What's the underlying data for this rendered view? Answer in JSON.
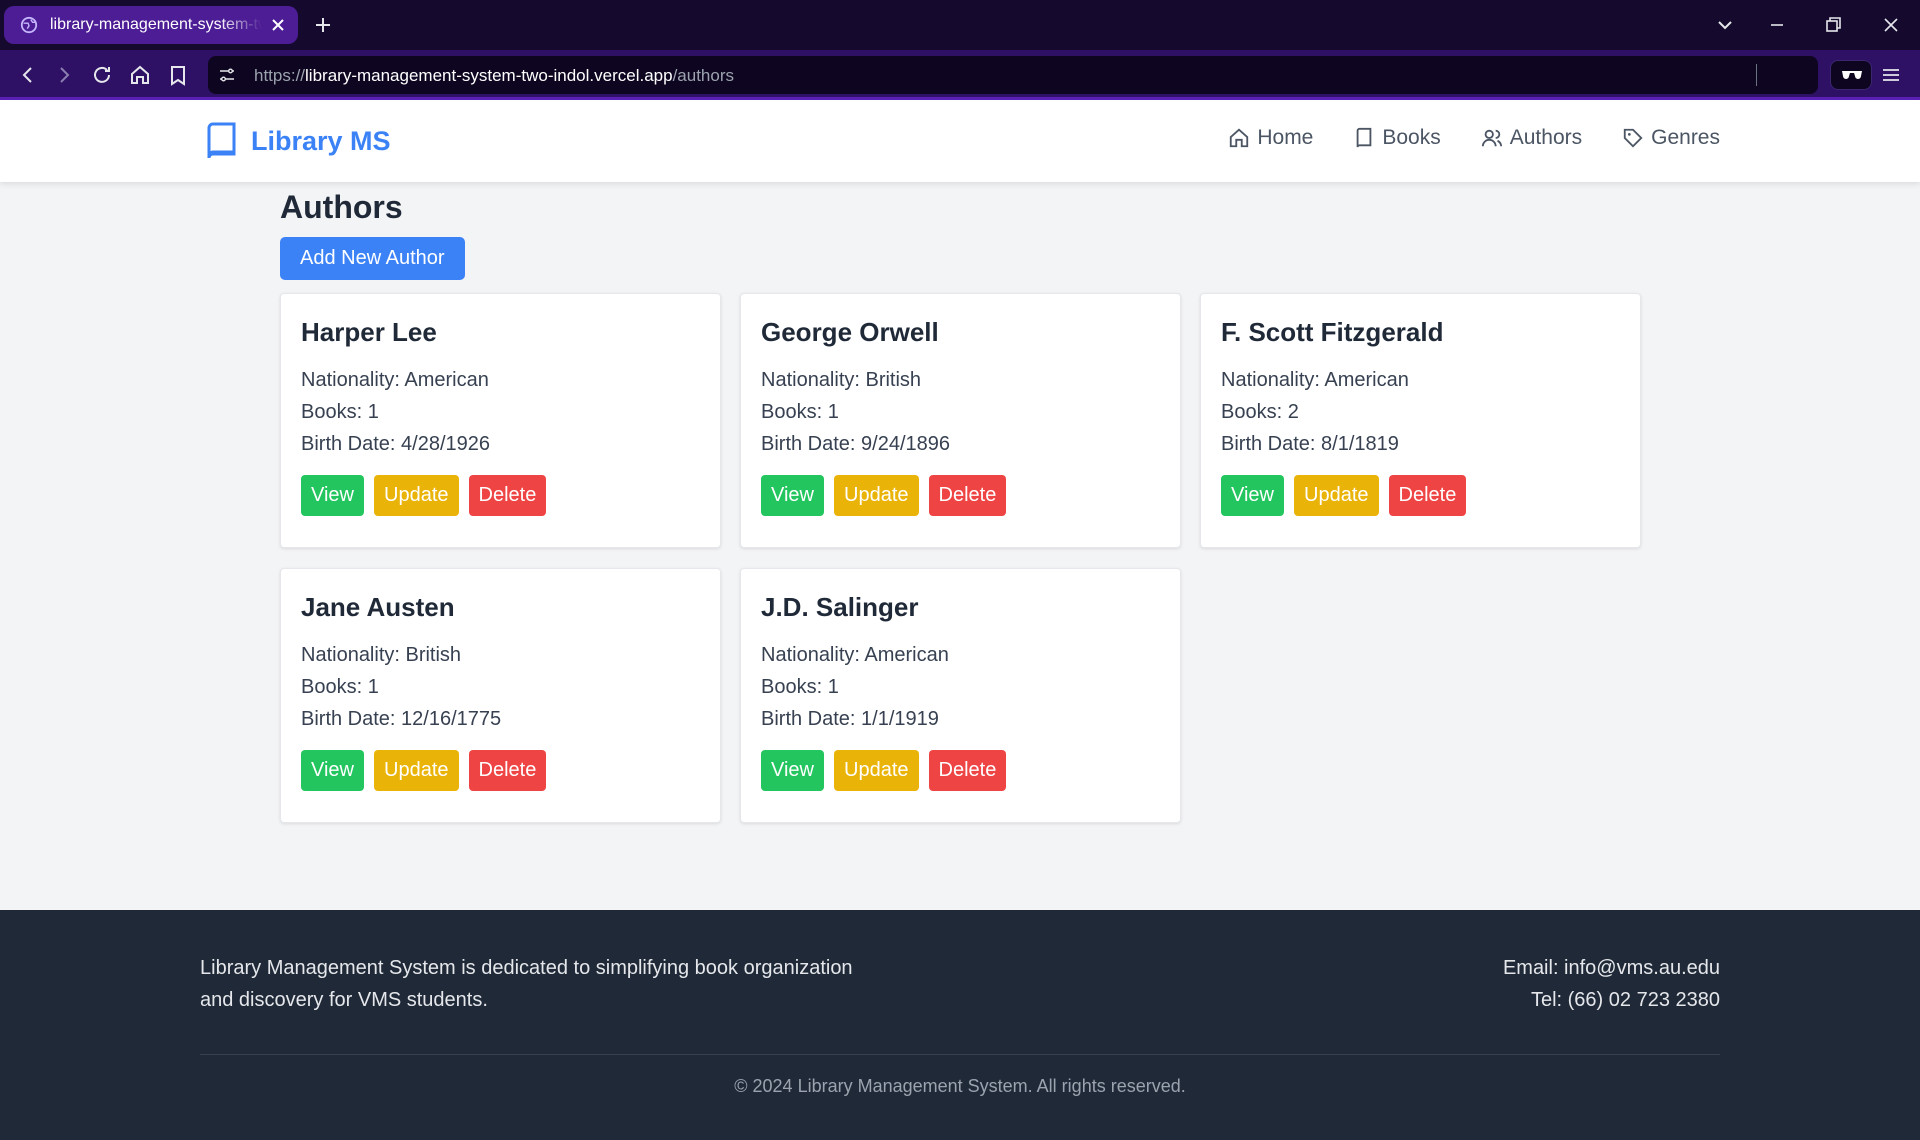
{
  "browser": {
    "tab_title": "library-management-system-two-indol.vercel.app",
    "url_scheme": "https://",
    "url_host": "library-management-system-two-indol.vercel.app",
    "url_path": "/authors"
  },
  "header": {
    "brand": "Library MS",
    "nav": [
      {
        "label": "Home",
        "icon": "home-icon"
      },
      {
        "label": "Books",
        "icon": "book-icon"
      },
      {
        "label": "Authors",
        "icon": "users-icon"
      },
      {
        "label": "Genres",
        "icon": "tag-icon"
      }
    ]
  },
  "main": {
    "title": "Authors",
    "add_button": "Add New Author",
    "authors": [
      {
        "name": "Harper Lee",
        "nationality": "Nationality: American",
        "books": "Books: 1",
        "birth": "Birth Date: 4/28/1926"
      },
      {
        "name": "George Orwell",
        "nationality": "Nationality: British",
        "books": "Books: 1",
        "birth": "Birth Date: 9/24/1896"
      },
      {
        "name": "F. Scott Fitzgerald",
        "nationality": "Nationality: American",
        "books": "Books: 2",
        "birth": "Birth Date: 8/1/1819"
      },
      {
        "name": "Jane Austen",
        "nationality": "Nationality: British",
        "books": "Books: 1",
        "birth": "Birth Date: 12/16/1775"
      },
      {
        "name": "J.D. Salinger",
        "nationality": "Nationality: American",
        "books": "Books: 1",
        "birth": "Birth Date: 1/1/1919"
      }
    ],
    "actions": {
      "view": "View",
      "update": "Update",
      "delete": "Delete"
    }
  },
  "footer": {
    "about_line1": "Library Management System is dedicated to simplifying book organization",
    "about_line2": "and discovery for VMS students.",
    "email": "Email: info@vms.au.edu",
    "tel": "Tel: (66) 02 723 2380",
    "copyright": "© 2024 Library Management System. All rights reserved."
  },
  "colors": {
    "primary": "#3b82f6",
    "view": "#22c55e",
    "update": "#eab308",
    "delete": "#ef4444",
    "footer_bg": "#1f2937"
  }
}
